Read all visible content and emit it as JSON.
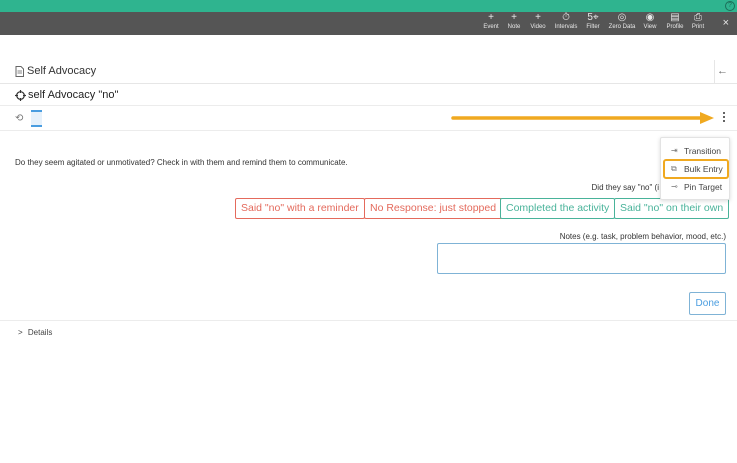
{
  "header": {
    "help_label": "?"
  },
  "toolbar": {
    "items": [
      {
        "icon": "plus-icon",
        "glyph": "+",
        "label": "Event"
      },
      {
        "icon": "plus-icon",
        "glyph": "+",
        "label": "Note"
      },
      {
        "icon": "plus-icon",
        "glyph": "+",
        "label": "Video"
      },
      {
        "icon": "stopwatch-icon",
        "glyph": "⏱",
        "label": "Intervals"
      },
      {
        "icon": "target-filter-icon",
        "glyph": "5⌖",
        "label": "Filter"
      },
      {
        "icon": "zero-data-icon",
        "glyph": "◎",
        "label": "Zero Data"
      },
      {
        "icon": "eye-icon",
        "glyph": "◉",
        "label": "View"
      },
      {
        "icon": "profile-card-icon",
        "glyph": "▤",
        "label": "Profile"
      },
      {
        "icon": "printer-icon",
        "glyph": "⎙",
        "label": "Print"
      }
    ],
    "close_glyph": "×"
  },
  "program": {
    "title": "Self Advocacy",
    "back_glyph": "←"
  },
  "target": {
    "title": "self Advocacy \"no\""
  },
  "history": {
    "icon_glyph": "⟲"
  },
  "session": {
    "prompt": "Do they seem agitated or unmotivated?  Check in with them and remind them to communicate.",
    "question": "Did they say \"no\" (i",
    "options": [
      "Said \"no\" with a reminder",
      "No Response: just stopped",
      "Completed the activity",
      "Said \"no\" on their own"
    ],
    "notes_label": "Notes (e.g. task, problem behavior, mood, etc.)",
    "notes_value": "",
    "done_label": "Done",
    "details_label": "Details",
    "details_glyph": ">"
  },
  "menu": {
    "items": [
      {
        "glyph": "⇥",
        "label": "Transition"
      },
      {
        "glyph": "⧉",
        "label": "Bulk Entry"
      },
      {
        "glyph": "⊸",
        "label": "Pin Target"
      }
    ]
  },
  "colors": {
    "teal": "#2fb48f",
    "toolbar": "#555555",
    "highlight": "#f0a920",
    "red": "#e46a5c",
    "green": "#49b39a",
    "blue": "#4a9de0"
  }
}
